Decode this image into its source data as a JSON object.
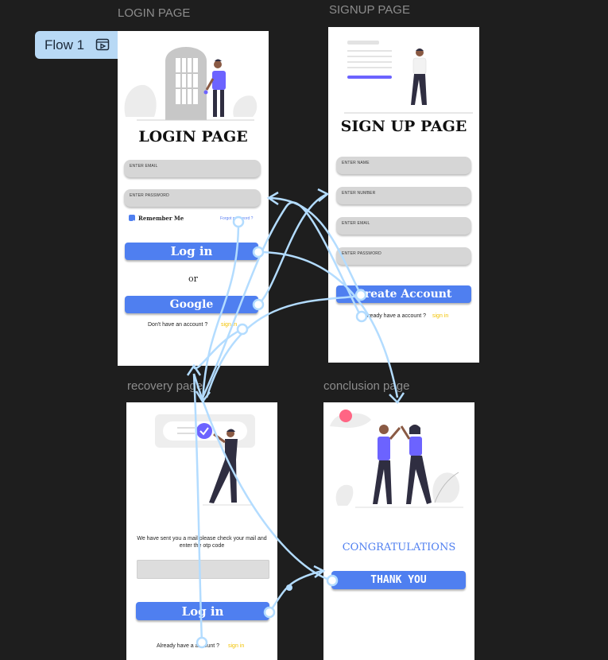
{
  "flow": {
    "label": "Flow 1",
    "icon": "play-frame-icon"
  },
  "frames": {
    "login": {
      "label": "LOGIN PAGE",
      "title": "LOGIN PAGE",
      "email_label": "ENTER EMAIL",
      "password_label": "ENTER PASSWORD",
      "remember_label": "Remember Me",
      "forgot_label": "Forgot password ?",
      "login_button": "Log in",
      "or_text": "or",
      "google_button": "Google",
      "no_account_text": "Don't have an account ?",
      "signup_link": "sign in"
    },
    "signup": {
      "label": "SIGNUP PAGE",
      "title": "SIGN UP PAGE",
      "name_label": "ENTER NAME",
      "number_label": "ENTER NUMBER",
      "email_label": "ENTER EMAIL",
      "password_label": "ENTER PASSWORD",
      "create_button": "Create Account",
      "have_account_text": "Already have a account ?",
      "signin_link": "sign in"
    },
    "recovery": {
      "label": "recovery page",
      "message_line1": "We have sent you a mail please check your mail and",
      "message_line2": "enter the otp code",
      "login_button": "Log in",
      "have_account_text": "Already have a account ?",
      "signin_link": "sign in"
    },
    "conclusion": {
      "label": "conclusion page",
      "congrats": "CONGRATULATIONS",
      "thank_button": "THANK YOU"
    }
  },
  "colors": {
    "canvas": "#1e1e1e",
    "accent": "#4f7ff0",
    "connector": "#b3dcff",
    "link_yellow": "#f2c200",
    "illustration_purple": "#6c63ff"
  }
}
